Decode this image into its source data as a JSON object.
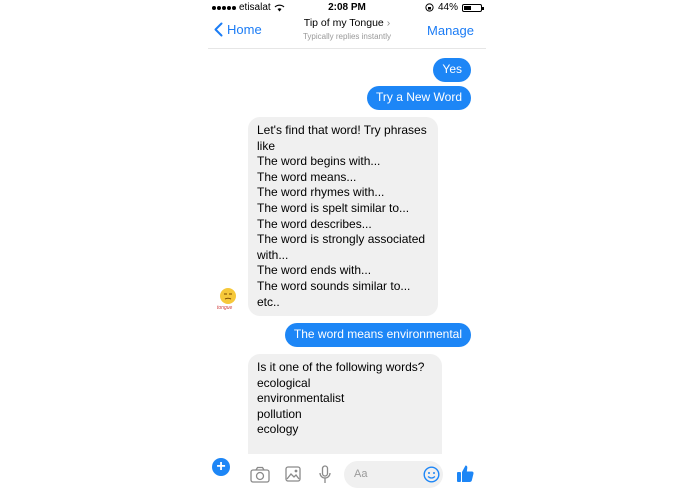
{
  "status": {
    "carrier": "etisalat",
    "time": "2:08 PM",
    "battery": "44%",
    "battery_level": 0.44
  },
  "nav": {
    "back_label": "Home",
    "title": "Tip of my Tongue",
    "subtitle": "Typically replies instantly",
    "manage_label": "Manage"
  },
  "messages": {
    "m1": "Yes",
    "m2": "Try a New Word",
    "m3_lines": [
      "Let's find that word! Try phrases",
      "like",
      "The word begins with...",
      "The word means...",
      "The word rhymes with...",
      "The word is spelt similar to...",
      "The word describes...",
      "The word is strongly associated",
      "with...",
      "The word ends with...",
      "The word sounds similar to...",
      "etc.."
    ],
    "m4": "The word means environmental",
    "m5_lines": [
      "Is it one of the following words?",
      "",
      "ecological",
      "environmentalist",
      "pollution",
      "ecology"
    ]
  },
  "avatar_label": "tongue",
  "composer": {
    "placeholder": "Aa"
  },
  "icons": [
    "plus-icon",
    "camera-icon",
    "gallery-icon",
    "microphone-icon",
    "emoji-icon",
    "thumbs-up-icon"
  ],
  "colors": {
    "accent": "#1d86f6",
    "incoming": "#f0f0f0"
  }
}
